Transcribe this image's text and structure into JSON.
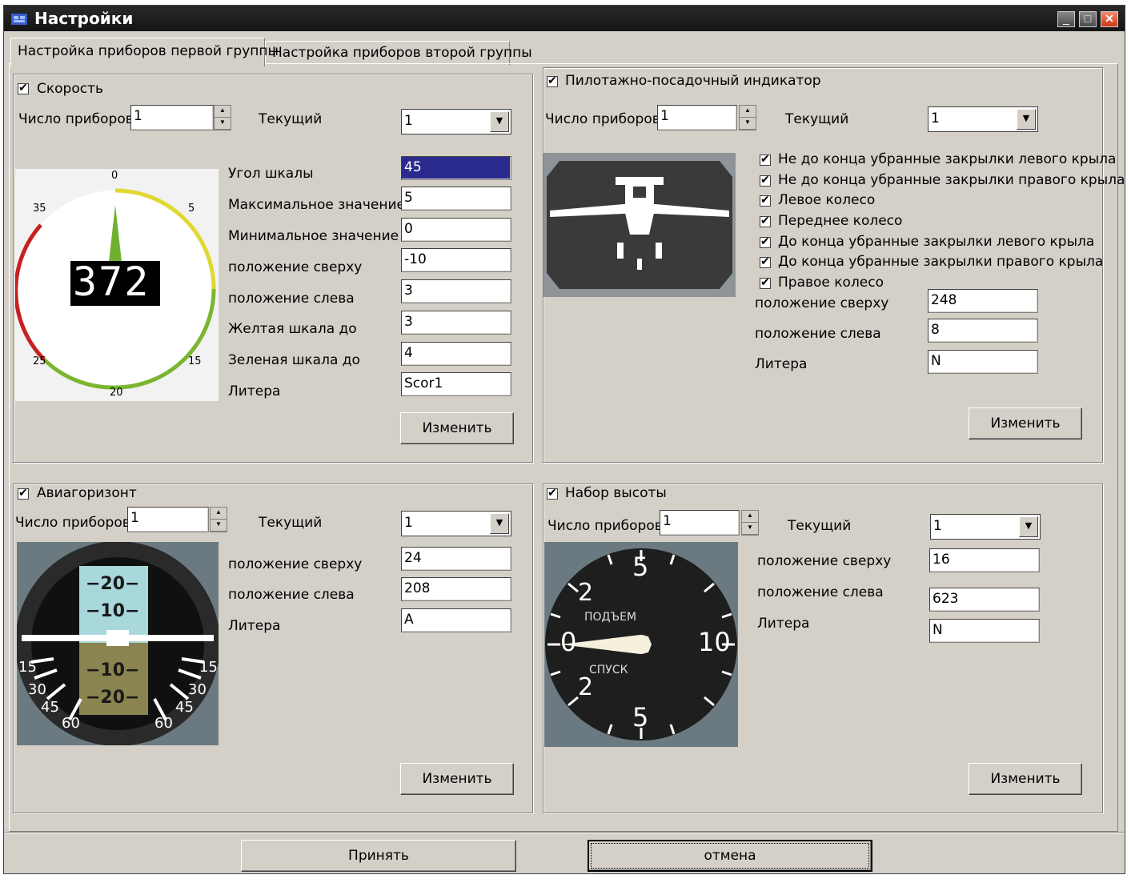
{
  "window": {
    "title": "Настройки"
  },
  "tabs": [
    "Настройка приборов первой группы",
    "Настройка приборов второй группы"
  ],
  "common": {
    "count_label": "Число приборов",
    "current_label": "Текущий",
    "change_label": "Изменить"
  },
  "speed": {
    "title": "Скорость",
    "count": "1",
    "current": "1",
    "fields": [
      {
        "label": "Угол  шкалы",
        "value": "45"
      },
      {
        "label": "Максимальное значение",
        "value": "5"
      },
      {
        "label": "Минимальное значение",
        "value": "0"
      },
      {
        "label": "положение сверху",
        "value": "-10"
      },
      {
        "label": "положение слева",
        "value": "3"
      },
      {
        "label": "Желтая шкала до",
        "value": "3"
      },
      {
        "label": "Зеленая шкала до",
        "value": "4"
      },
      {
        "label": "Литера",
        "value": "Scor1"
      }
    ],
    "gauge": {
      "display": "372",
      "ticks": [
        "0",
        "5",
        "35",
        "25",
        "15",
        "20"
      ]
    }
  },
  "pilot": {
    "title": "Пилотажно-посадочный индикатор",
    "count": "1",
    "current": "1",
    "checks": [
      "Не до конца убранные закрылки левого крыла",
      "Не до конца убранные закрылки правого крыла",
      "Левое колесо",
      "Переднее колесо",
      "До конца убранные закрылки левого крыла",
      "До конца убранные закрылки правого крыла",
      "Правое колесо"
    ],
    "fields": [
      {
        "label": "положение сверху",
        "value": "248"
      },
      {
        "label": "положение слева",
        "value": "8"
      },
      {
        "label": "Литера",
        "value": "N"
      }
    ]
  },
  "horizon": {
    "title": "Авиагоризонт",
    "count": "1",
    "current": "1",
    "fields": [
      {
        "label": "положение сверху",
        "value": "24"
      },
      {
        "label": "положение слева",
        "value": "208"
      },
      {
        "label": "Литера",
        "value": "A"
      }
    ],
    "pitch": [
      "−20−",
      "−10−",
      "−10−",
      "−20−"
    ],
    "roll": [
      "15",
      "30",
      "45",
      "60",
      "15",
      "30",
      "45",
      "60"
    ]
  },
  "climb": {
    "title": "Набор высоты",
    "count": "1",
    "current": "1",
    "fields": [
      {
        "label": "положение сверху",
        "value": "16"
      },
      {
        "label": "положение слева",
        "value": "623"
      },
      {
        "label": "Литера",
        "value": "N"
      }
    ],
    "dial": {
      "top": "5",
      "bottom": "5",
      "left": "0",
      "right": "10",
      "upper2": "2",
      "lower2": "2",
      "up": "ПОДЪЕМ",
      "down": "СПУСК"
    }
  },
  "footer": {
    "accept": "Принять",
    "cancel": "отмена"
  },
  "colors": {
    "selection": "#2b2b8f",
    "face": "#d4d0c8",
    "titlebar": "#1c1c1c"
  }
}
